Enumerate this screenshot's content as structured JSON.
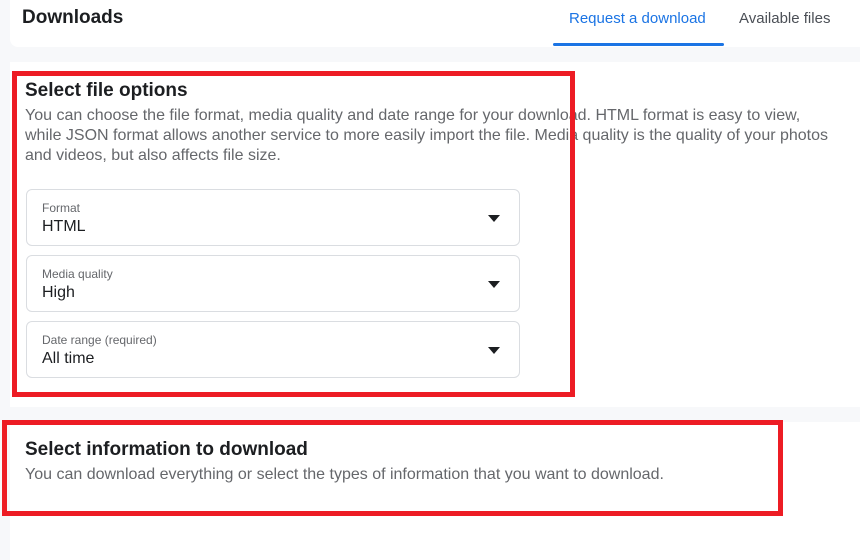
{
  "header": {
    "title": "Downloads",
    "tabs": [
      {
        "label": "Request a download",
        "active": true
      },
      {
        "label": "Available files",
        "active": false
      }
    ]
  },
  "file_options": {
    "title": "Select file options",
    "description": "You can choose the file format, media quality and date range for your download. HTML format is easy to view, while JSON format allows another service to more easily import the file. Media quality is the quality of your photos and videos, but also affects file size.",
    "selects": [
      {
        "label": "Format",
        "value": "HTML"
      },
      {
        "label": "Media quality",
        "value": "High"
      },
      {
        "label": "Date range (required)",
        "value": "All time"
      }
    ]
  },
  "information": {
    "title": "Select information to download",
    "description": "You can download everything or select the types of information that you want to download."
  },
  "colors": {
    "accent": "#1b74e4",
    "annotation": "#ed1c24",
    "background": "#f7f8fa"
  },
  "icons": {
    "dropdown": "caret-down-icon"
  }
}
